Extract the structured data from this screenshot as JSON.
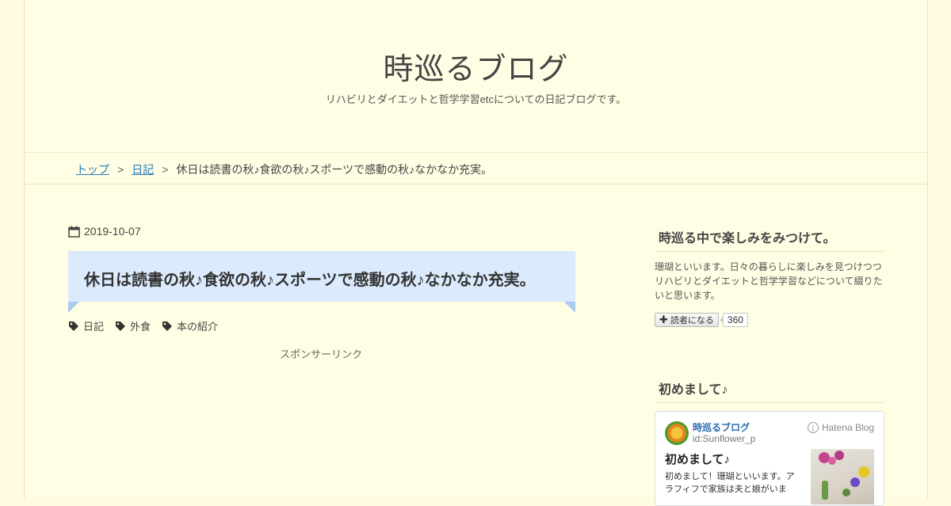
{
  "header": {
    "blog_title": "時巡るブログ",
    "blog_description": "リハビリとダイエットと哲学学習etcについての日記ブログです。"
  },
  "breadcrumb": {
    "home": "トップ",
    "category": "日記",
    "separator": ">",
    "current": "休日は読書の秋♪食欲の秋♪スポーツで感動の秋♪なかなか充実。"
  },
  "entry": {
    "date": "2019-10-07",
    "title": "休日は読書の秋♪食欲の秋♪スポーツで感動の秋♪なかなか充実。",
    "categories": [
      "日記",
      "外食",
      "本の紹介"
    ],
    "sponsor_label": "スポンサーリンク"
  },
  "sidebar": {
    "about": {
      "title": "時巡る中で楽しみをみつけて。",
      "text": "珊瑚といいます。日々の暮らしに楽しみを見つけつつリハビリとダイエットと哲学学習などについて綴りたいと思います。",
      "reader_button": "読者になる",
      "reader_count": "360"
    },
    "intro": {
      "title": "初めまして♪",
      "card": {
        "blog_name": "時巡るブログ",
        "user_id": "id:Sunflower_p",
        "service": "Hatena Blog",
        "entry_title": "初めまして♪",
        "excerpt": "初めまして！珊瑚といいます。アラフィフで家族は夫と娘がいま"
      }
    }
  },
  "colors": {
    "page_bg": "#fffce0",
    "title_box": "#dbeafc",
    "ribbon": "#aacbef",
    "link": "#2b7bb9"
  }
}
